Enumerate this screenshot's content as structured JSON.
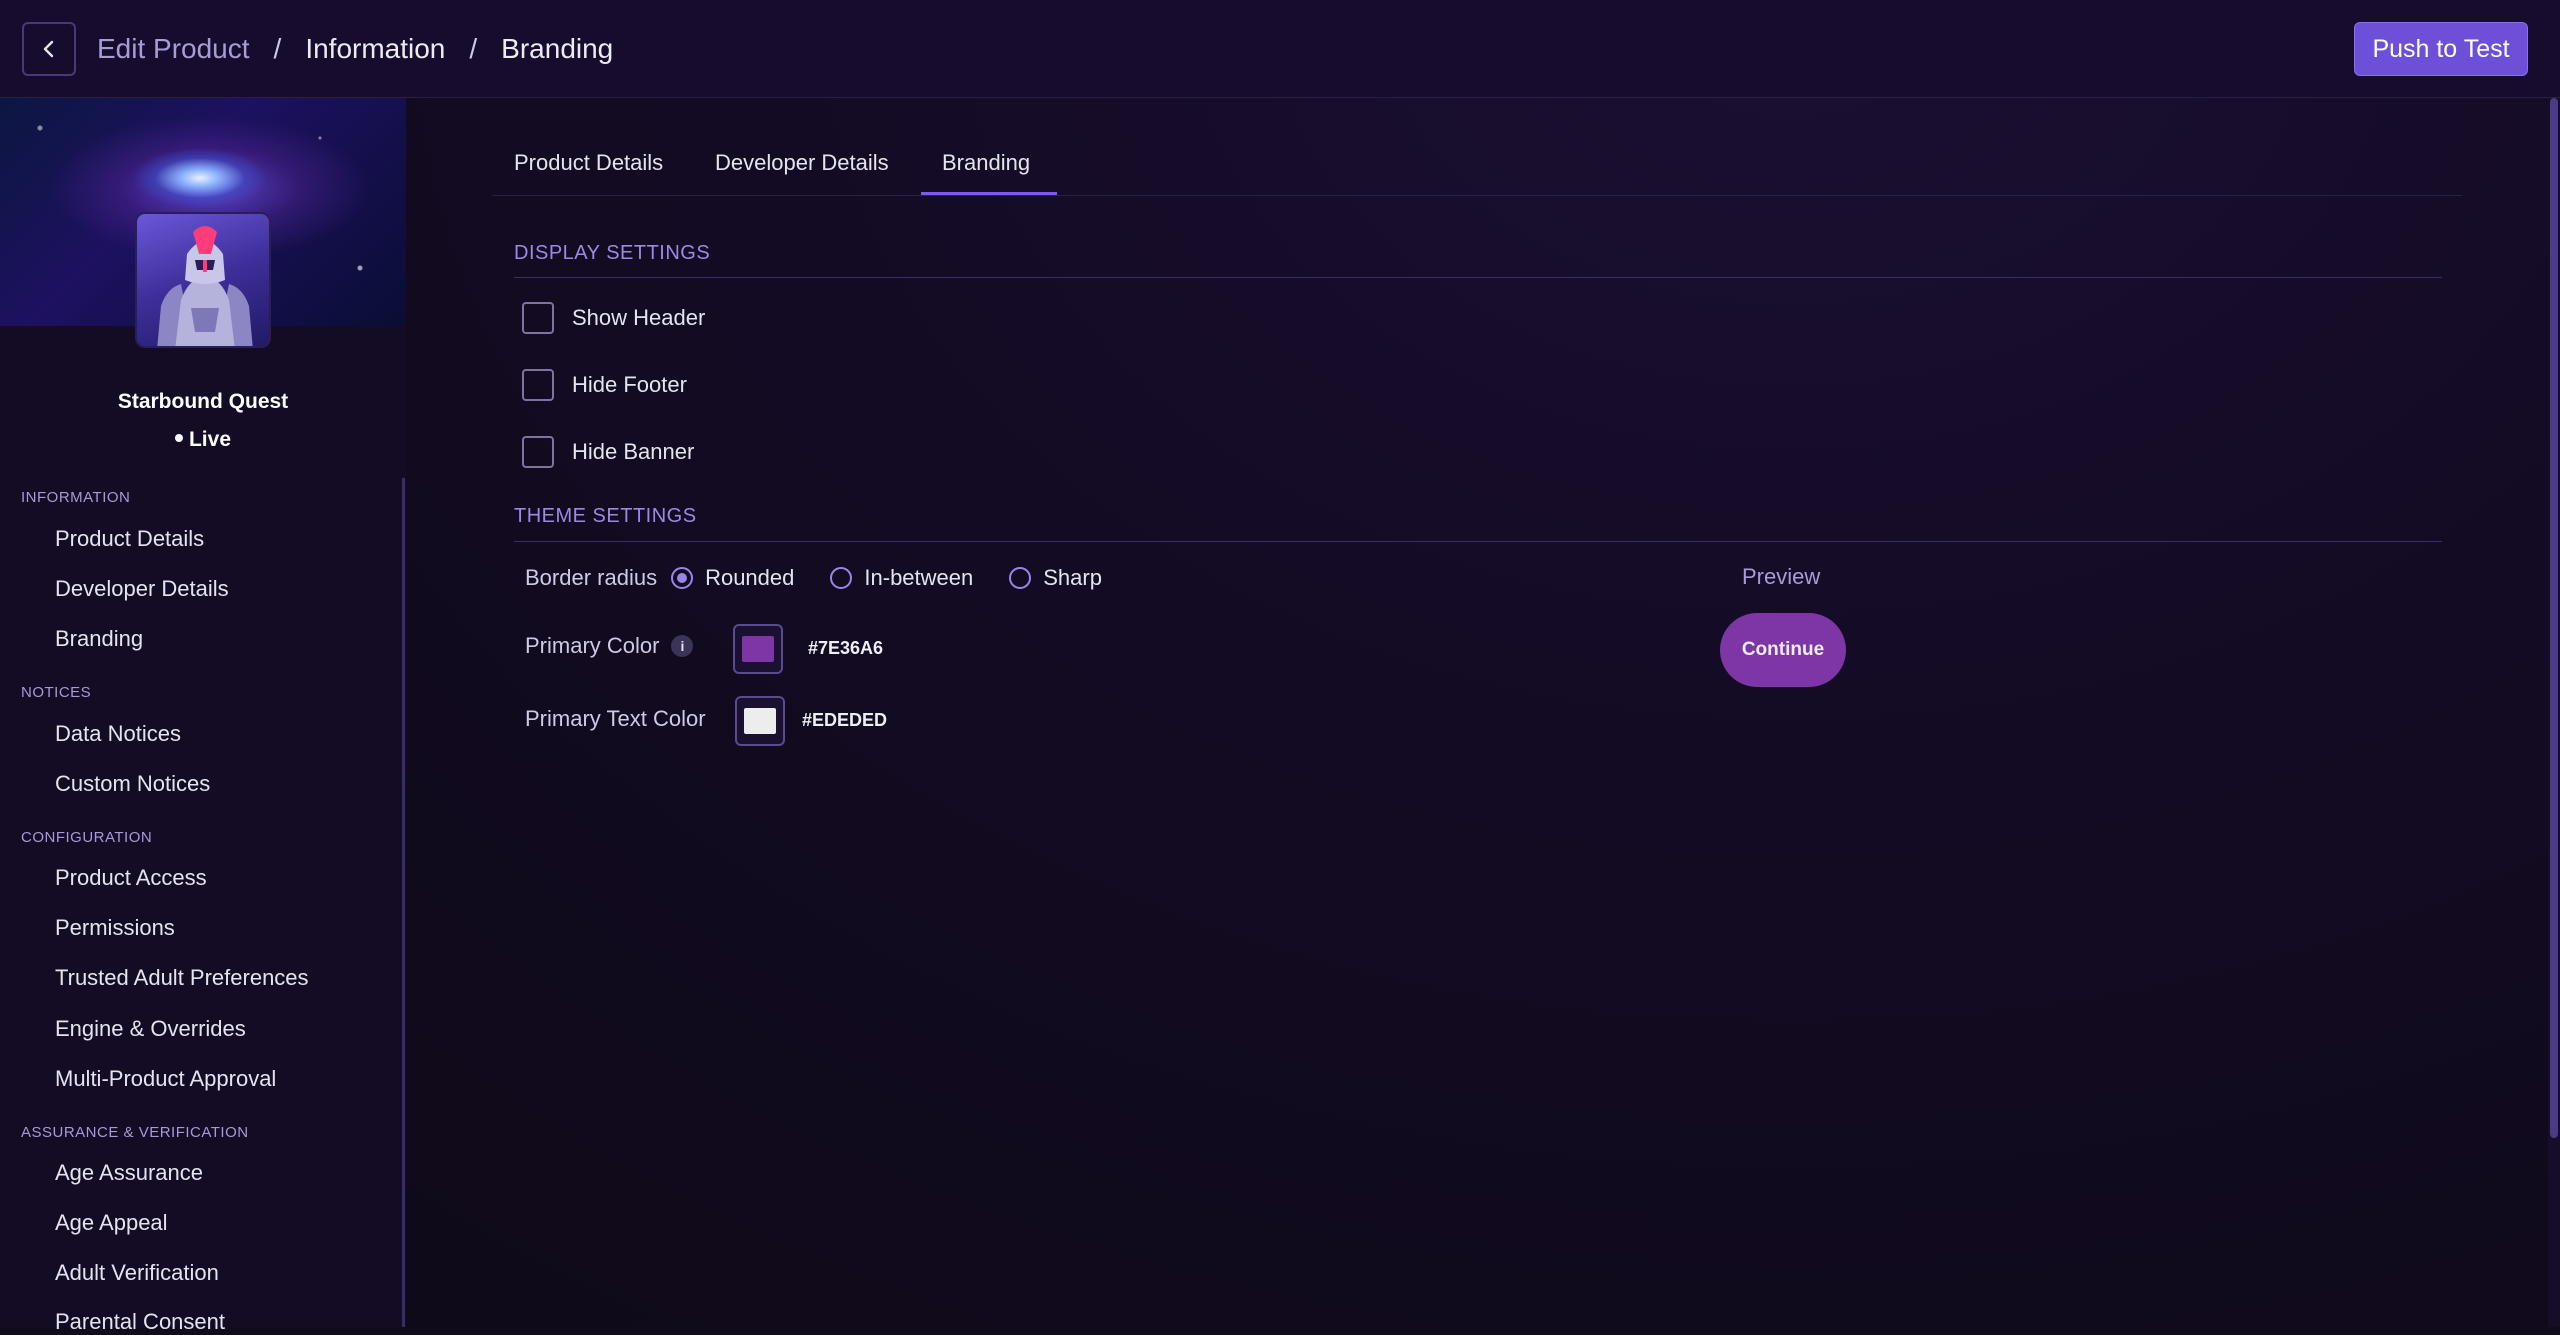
{
  "header": {
    "breadcrumb": [
      "Edit Product",
      "Information",
      "Branding"
    ],
    "separator": "/",
    "push_label": "Push to Test"
  },
  "product": {
    "name": "Starbound Quest",
    "status": "Live"
  },
  "sidebar": {
    "sections": [
      {
        "label": "INFORMATION",
        "items": [
          "Product Details",
          "Developer Details",
          "Branding"
        ]
      },
      {
        "label": "NOTICES",
        "items": [
          "Data Notices",
          "Custom Notices"
        ]
      },
      {
        "label": "CONFIGURATION",
        "items": [
          "Product Access",
          "Permissions",
          "Trusted Adult Preferences",
          "Engine & Overrides",
          "Multi-Product Approval"
        ]
      },
      {
        "label": "ASSURANCE & VERIFICATION",
        "items": [
          "Age Assurance",
          "Age Appeal",
          "Adult Verification",
          "Parental Consent"
        ]
      }
    ]
  },
  "tabs": [
    "Product Details",
    "Developer Details",
    "Branding"
  ],
  "active_tab": "Branding",
  "display_settings": {
    "heading": "DISPLAY SETTINGS",
    "options": [
      {
        "label": "Show Header",
        "checked": false
      },
      {
        "label": "Hide Footer",
        "checked": false
      },
      {
        "label": "Hide Banner",
        "checked": false
      }
    ]
  },
  "theme_settings": {
    "heading": "THEME SETTINGS",
    "border_radius_label": "Border radius",
    "border_radius_options": [
      "Rounded",
      "In-between",
      "Sharp"
    ],
    "border_radius_selected": "Rounded",
    "primary_color_label": "Primary Color",
    "primary_color": "#7E36A6",
    "primary_text_color_label": "Primary Text Color",
    "primary_text_color": "#EDEDED"
  },
  "preview": {
    "label": "Preview",
    "button_label": "Continue"
  },
  "colors": {
    "accent": "#6d4fd8",
    "background": "#110b1e"
  }
}
